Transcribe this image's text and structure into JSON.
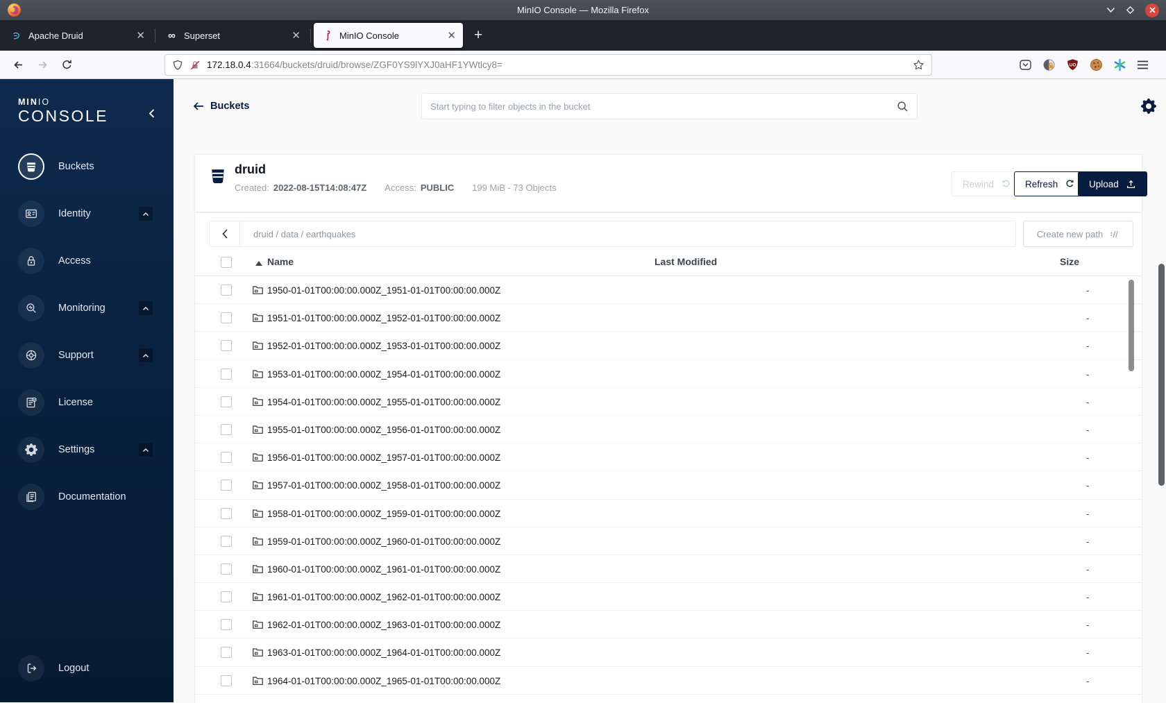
{
  "window": {
    "title": "MinIO Console — Mozilla Firefox"
  },
  "browser_chrome": {
    "tabs": [
      {
        "label": "Apache Druid",
        "favicon": "druid-icon",
        "active": false
      },
      {
        "label": "Superset",
        "favicon": "superset-icon",
        "active": false
      },
      {
        "label": "MinIO Console",
        "favicon": "minio-flamingo-icon",
        "active": true
      }
    ],
    "tab_close_glyph": "✕",
    "new_tab_glyph": "+",
    "url": {
      "host": "172.18.0.4",
      "rest": ":31664/buckets/druid/browse/ZGF0YS9lYXJ0aHF1YWtlcy8="
    }
  },
  "sidebar": {
    "logo_min": "MIN",
    "logo_io": "IO",
    "logo_console": "CONSOLE",
    "items": [
      {
        "label": "Buckets",
        "icon": "bucket-icon",
        "active": true
      },
      {
        "label": "Identity",
        "icon": "identity-card-icon",
        "expandable": true
      },
      {
        "label": "Access",
        "icon": "lock-icon"
      },
      {
        "label": "Monitoring",
        "icon": "monitoring-magnifier-icon",
        "expandable": true
      },
      {
        "label": "Support",
        "icon": "support-icon",
        "expandable": true
      },
      {
        "label": "License",
        "icon": "license-document-icon"
      },
      {
        "label": "Settings",
        "icon": "gear-icon",
        "expandable": true
      },
      {
        "label": "Documentation",
        "icon": "documentation-icon"
      }
    ],
    "logout": {
      "label": "Logout",
      "icon": "logout-icon"
    }
  },
  "header": {
    "back_label": "Buckets",
    "search_placeholder": "Start typing to filter objects in the bucket"
  },
  "bucket": {
    "name": "druid",
    "created_label": "Created:",
    "created": "2022-08-15T14:08:47Z",
    "access_label": "Access:",
    "access": "PUBLIC",
    "usage": "199 MiB - 73 Objects",
    "rewind_label": "Rewind",
    "refresh_label": "Refresh",
    "upload_label": "Upload"
  },
  "objects": {
    "breadcrumb": "druid / data / earthquakes",
    "create_path_label": "Create new path",
    "columns": {
      "name": "Name",
      "modified": "Last Modified",
      "size": "Size"
    },
    "rows": [
      {
        "name": "1950-01-01T00:00:00.000Z_1951-01-01T00:00:00.000Z",
        "size": "-"
      },
      {
        "name": "1951-01-01T00:00:00.000Z_1952-01-01T00:00:00.000Z",
        "size": "-"
      },
      {
        "name": "1952-01-01T00:00:00.000Z_1953-01-01T00:00:00.000Z",
        "size": "-"
      },
      {
        "name": "1953-01-01T00:00:00.000Z_1954-01-01T00:00:00.000Z",
        "size": "-"
      },
      {
        "name": "1954-01-01T00:00:00.000Z_1955-01-01T00:00:00.000Z",
        "size": "-"
      },
      {
        "name": "1955-01-01T00:00:00.000Z_1956-01-01T00:00:00.000Z",
        "size": "-"
      },
      {
        "name": "1956-01-01T00:00:00.000Z_1957-01-01T00:00:00.000Z",
        "size": "-"
      },
      {
        "name": "1957-01-01T00:00:00.000Z_1958-01-01T00:00:00.000Z",
        "size": "-"
      },
      {
        "name": "1958-01-01T00:00:00.000Z_1959-01-01T00:00:00.000Z",
        "size": "-"
      },
      {
        "name": "1959-01-01T00:00:00.000Z_1960-01-01T00:00:00.000Z",
        "size": "-"
      },
      {
        "name": "1960-01-01T00:00:00.000Z_1961-01-01T00:00:00.000Z",
        "size": "-"
      },
      {
        "name": "1961-01-01T00:00:00.000Z_1962-01-01T00:00:00.000Z",
        "size": "-"
      },
      {
        "name": "1962-01-01T00:00:00.000Z_1963-01-01T00:00:00.000Z",
        "size": "-"
      },
      {
        "name": "1963-01-01T00:00:00.000Z_1964-01-01T00:00:00.000Z",
        "size": "-"
      },
      {
        "name": "1964-01-01T00:00:00.000Z_1965-01-01T00:00:00.000Z",
        "size": "-"
      }
    ]
  },
  "colors": {
    "accent_navy": "#081C42",
    "sidebar_top": "#0e2a4e",
    "sidebar_bottom": "#071a33",
    "active_tab_bg": "#f9f9fb",
    "titlebar": "#454c54",
    "close_button_red": "#d8453e",
    "minio_red": "#c51c4f",
    "ublock_red": "#7f1416"
  }
}
